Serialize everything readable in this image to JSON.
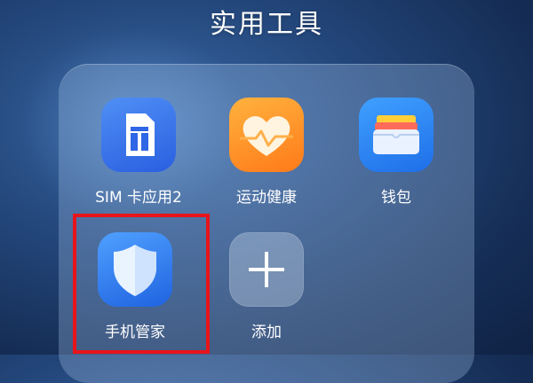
{
  "folder": {
    "title": "实用工具"
  },
  "apps": [
    {
      "label": "SIM 卡应用2",
      "icon": "sim-card-icon",
      "color": "#2a5fe0"
    },
    {
      "label": "运动健康",
      "icon": "heart-pulse-icon",
      "color": "#ff8a1f"
    },
    {
      "label": "钱包",
      "icon": "wallet-icon",
      "color": "#1f6fe8"
    },
    {
      "label": "手机管家",
      "icon": "shield-icon",
      "color": "#1f63e0",
      "highlighted": true
    },
    {
      "label": "添加",
      "icon": "plus-icon",
      "color": "#c8d7eb"
    }
  ],
  "highlight": {
    "color": "#e8141b",
    "target": "手机管家"
  }
}
